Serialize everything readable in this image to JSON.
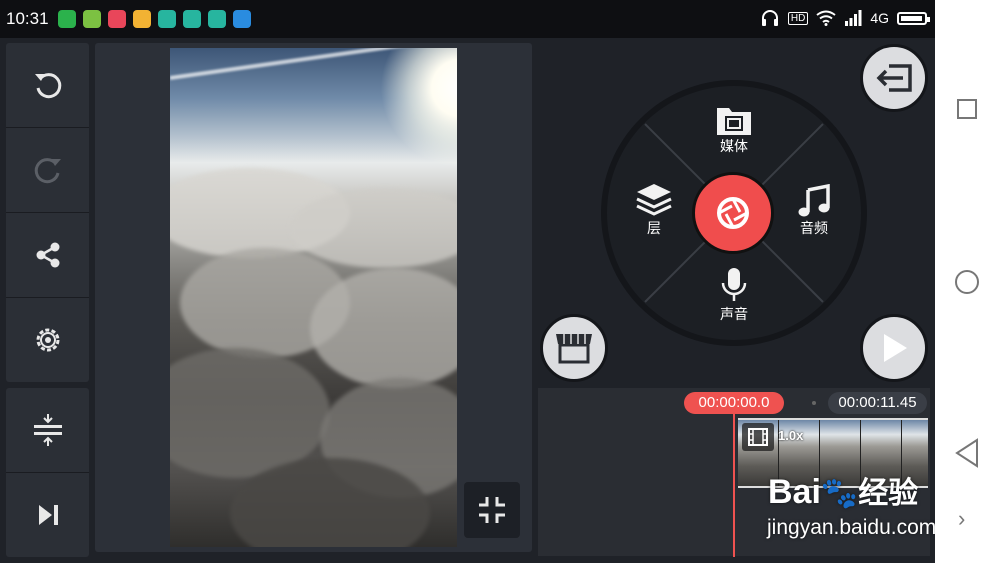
{
  "status_bar": {
    "time": "10:31",
    "network": "4G",
    "hd": "HD",
    "app_icon_colors": [
      "#2bb24c",
      "#7cc142",
      "#e9465a",
      "#f2b233",
      "#27b59f",
      "#27b59f",
      "#27b59f",
      "#2a8ce0"
    ]
  },
  "toolbar": {
    "items": [
      {
        "name": "undo",
        "enabled": true
      },
      {
        "name": "redo",
        "enabled": false
      },
      {
        "name": "share",
        "enabled": true
      },
      {
        "name": "settings",
        "enabled": true
      },
      {
        "name": "adjust-timeline",
        "enabled": true
      },
      {
        "name": "skip-to-end",
        "enabled": true
      }
    ]
  },
  "menu": {
    "media_label": "媒体",
    "layer_label": "层",
    "audio_label": "音频",
    "voice_label": "声音"
  },
  "timeline": {
    "current_time": "00:00:00.0",
    "total_time": "00:00:11.45",
    "clip_speed": "1.0x"
  },
  "watermark": {
    "brand_a": "Bai",
    "brand_b": "经验",
    "url": "jingyan.baidu.com"
  },
  "colors": {
    "accent_red": "#ef5250",
    "panel": "#2b2f36",
    "background": "#1f2228"
  }
}
